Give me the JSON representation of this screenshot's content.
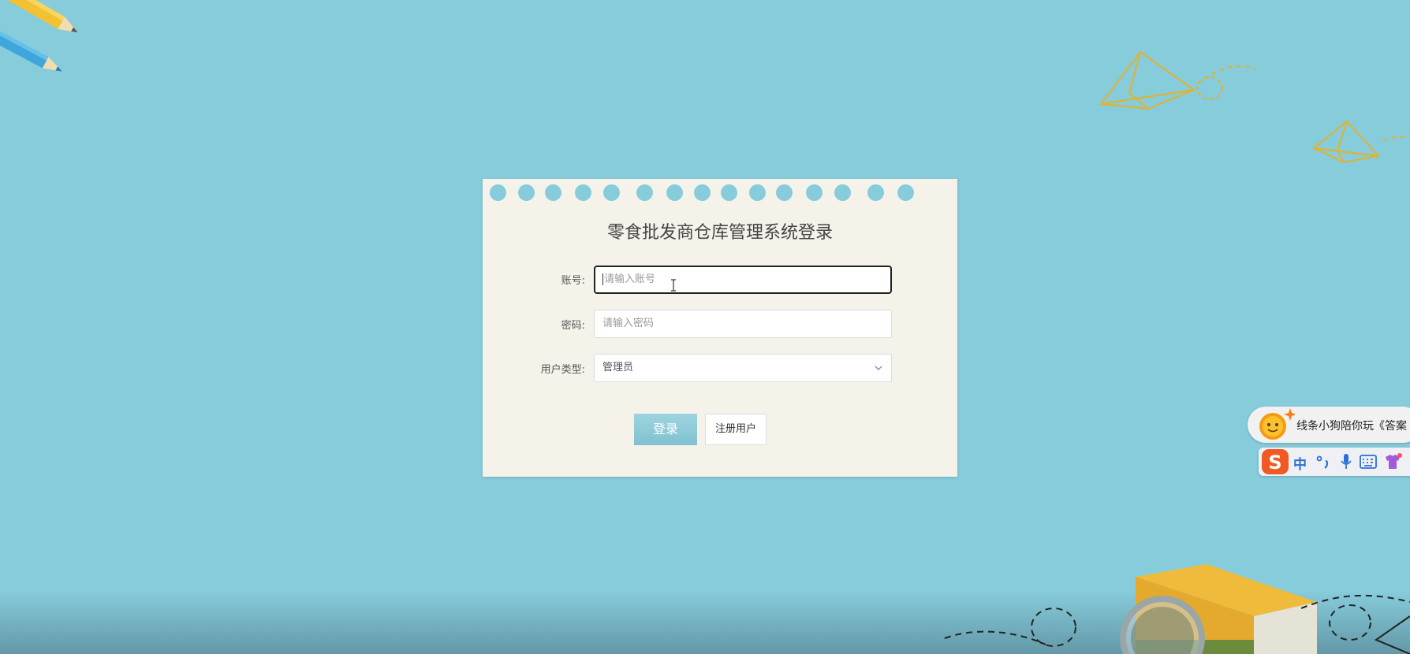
{
  "login": {
    "title": "零食批发商仓库管理系统登录",
    "account_label": "账号:",
    "account_placeholder": "请输入账号",
    "password_label": "密码:",
    "password_placeholder": "请输入密码",
    "usertype_label": "用户类型:",
    "usertype_value": "管理员",
    "login_button": "登录",
    "register_button": "注册用户"
  },
  "ime": {
    "notice_text": "线条小狗陪你玩《答案",
    "mode_label": "中"
  },
  "colors": {
    "background": "#86ccdb",
    "card": "#f5f2ea",
    "login_button": "#8ccad8",
    "accent_yellow": "#e8b83a"
  },
  "icons": [
    "pencil-icon",
    "paper-plane-icon",
    "book-icon",
    "magnifier-icon",
    "chevron-down-icon",
    "sun-mascot-icon",
    "sogou-logo-icon",
    "microphone-icon",
    "keyboard-icon",
    "skin-icon"
  ]
}
